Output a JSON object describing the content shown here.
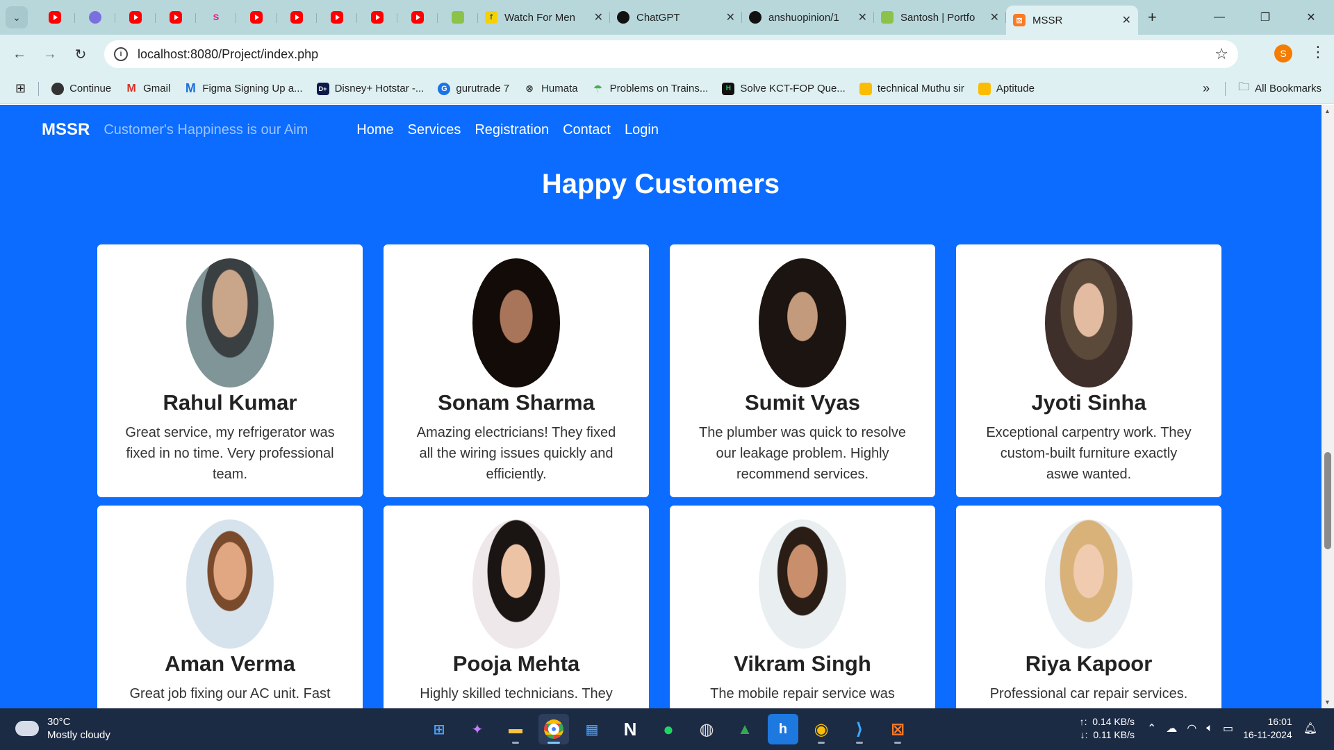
{
  "browser": {
    "tabs": [
      {
        "title": "Watch For Men",
        "favicon": "flipkart-icon"
      },
      {
        "title": "ChatGPT",
        "favicon": "chatgpt-icon"
      },
      {
        "title": "anshuopinion/1",
        "favicon": "github-icon"
      },
      {
        "title": "Santosh | Portfo",
        "favicon": "portfolio-icon"
      },
      {
        "title": "MSSR",
        "favicon": "xampp-icon",
        "active": true
      }
    ],
    "url": "localhost:8080/Project/index.php",
    "profile_initial": "S",
    "bookmarks": [
      {
        "label": "Continue",
        "icon": "globe-icon"
      },
      {
        "label": "Gmail",
        "icon": "gmail-icon"
      },
      {
        "label": "Figma Signing Up a...",
        "icon": "figma-icon"
      },
      {
        "label": "Disney+ Hotstar -...",
        "icon": "hotstar-icon"
      },
      {
        "label": "gurutrade 7",
        "icon": "gurutrade-icon"
      },
      {
        "label": "Humata",
        "icon": "humata-icon"
      },
      {
        "label": "Problems on Trains...",
        "icon": "umbrella-icon"
      },
      {
        "label": "Solve KCT-FOP Que...",
        "icon": "hackerrank-icon"
      },
      {
        "label": "technical Muthu sir",
        "icon": "classroom-icon"
      },
      {
        "label": "Aptitude",
        "icon": "classroom-icon"
      }
    ],
    "all_bookmarks": "All Bookmarks"
  },
  "site": {
    "brand": "MSSR",
    "tagline": "Customer's Happiness is our Aim",
    "nav": [
      "Home",
      "Services",
      "Registration",
      "Contact",
      "Login"
    ],
    "section_title": "Happy Customers",
    "customers": [
      {
        "name": "Rahul Kumar",
        "text": "Great service, my refrigerator was fixed in no time. Very professional team."
      },
      {
        "name": "Sonam Sharma",
        "text": "Amazing electricians! They fixed all the wiring issues quickly and efficiently."
      },
      {
        "name": "Sumit Vyas",
        "text": "The plumber was quick to resolve our leakage problem. Highly recommend services."
      },
      {
        "name": "Jyoti Sinha",
        "text": "Exceptional carpentry work. They custom-built furniture exactly aswe wanted."
      },
      {
        "name": "Aman Verma",
        "text": "Great job fixing our AC unit. Fast"
      },
      {
        "name": "Pooja Mehta",
        "text": "Highly skilled technicians. They"
      },
      {
        "name": "Vikram Singh",
        "text": "The mobile repair service was"
      },
      {
        "name": "Riya Kapoor",
        "text": "Professional car repair services. They"
      }
    ]
  },
  "taskbar": {
    "temperature": "30°C",
    "weather": "Mostly cloudy",
    "upload": "0.14 KB/s",
    "download": "0.11 KB/s",
    "upload_arrow": "↑:",
    "download_arrow": "↓:",
    "time": "16:01",
    "date": "16-11-2024"
  }
}
